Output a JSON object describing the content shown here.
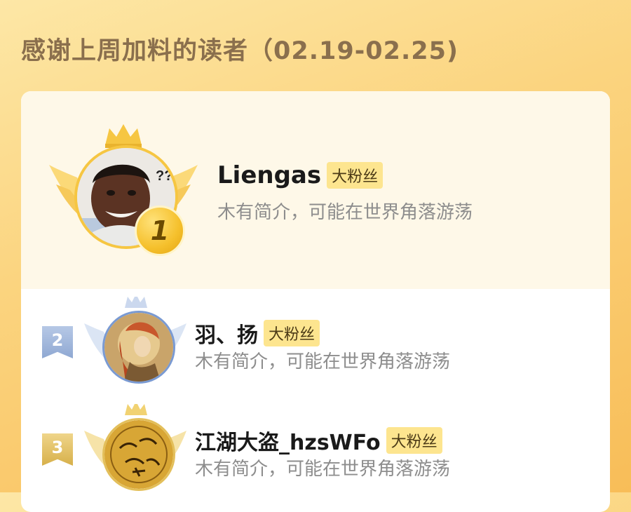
{
  "page": {
    "title": "感谢上周加料的读者（02.19-02.25)"
  },
  "leaderboard": [
    {
      "rank": "1",
      "name": "Liengas",
      "tag": "大粉丝",
      "desc": "木有简介，可能在世界角落游荡",
      "avatar_text": "??"
    },
    {
      "rank": "2",
      "name": "羽、扬",
      "tag": "大粉丝",
      "desc": "木有简介，可能在世界角落游荡"
    },
    {
      "rank": "3",
      "name": "江湖大盗_hzsWFo",
      "tag": "大粉丝",
      "desc": "木有简介，可能在世界角落游荡"
    }
  ],
  "colors": {
    "gold": "#f6c642",
    "silver": "#9db4dc",
    "bronze": "#e3bf5a",
    "tag_bg": "#fde58f"
  }
}
